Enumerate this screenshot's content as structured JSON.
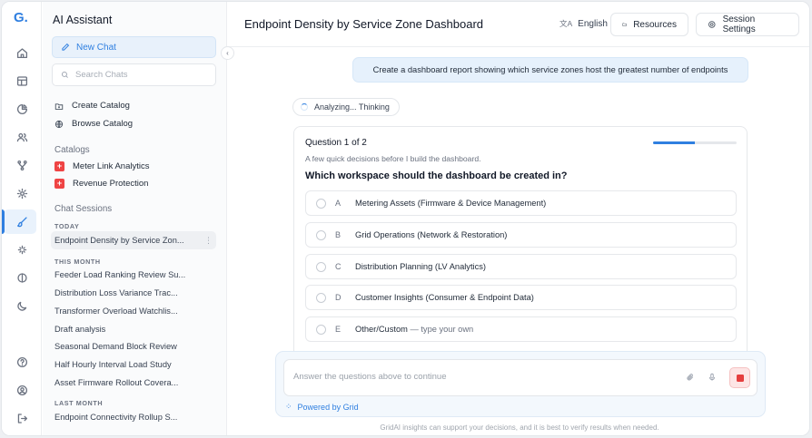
{
  "app": {
    "logo": "G."
  },
  "rail": {
    "icons": [
      "home-icon",
      "layout-icon",
      "pie-chart-icon",
      "users-icon",
      "branch-icon",
      "settings-icon",
      "brush-icon",
      "sparkle-icon",
      "toggle-icon",
      "moon-icon",
      "help-icon",
      "account-icon",
      "logout-icon"
    ],
    "active": "brush-icon"
  },
  "sidebar": {
    "title": "AI Assistant",
    "new_chat": "New Chat",
    "search_placeholder": "Search Chats",
    "create_catalog": "Create Catalog",
    "browse_catalog": "Browse Catalog",
    "catalogs_label": "Catalogs",
    "catalogs": [
      "Meter Link Analytics",
      "Revenue Protection"
    ],
    "sessions_label": "Chat Sessions",
    "groups": {
      "today": "TODAY",
      "this_month": "THIS MONTH",
      "last_month": "LAST MONTH"
    },
    "today": [
      "Endpoint Density by Service Zon..."
    ],
    "this_month": [
      "Feeder Load Ranking Review Su...",
      "Distribution Loss Variance Trac...",
      "Transformer Overload Watchlis...",
      "Draft analysis",
      "Seasonal Demand Block Review",
      "Half Hourly Interval Load Study",
      "Asset Firmware Rollout Covera..."
    ],
    "last_month": [
      "Endpoint Connectivity Rollup S..."
    ],
    "more": "⋮"
  },
  "header": {
    "title": "Endpoint Density by Service Zone Dashboard",
    "language_glyph": "文A",
    "language": "English",
    "resources": "Resources",
    "session_settings": "Session Settings"
  },
  "chat": {
    "user_message": "Create a dashboard report showing which service zones host the greatest number of endpoints",
    "status": "Analyzing... Thinking"
  },
  "question": {
    "counter": "Question 1 of 2",
    "progress": 0.5,
    "subtitle": "A few quick decisions before I build the dashboard.",
    "text": "Which workspace should the dashboard be created in?",
    "options": [
      {
        "letter": "A",
        "label": "Metering Assets (Firmware & Device Management)",
        "hint": ""
      },
      {
        "letter": "B",
        "label": "Grid Operations (Network & Restoration)",
        "hint": ""
      },
      {
        "letter": "C",
        "label": "Distribution Planning (LV Analytics)",
        "hint": ""
      },
      {
        "letter": "D",
        "label": "Customer Insights (Consumer & Endpoint Data)",
        "hint": ""
      },
      {
        "letter": "E",
        "label": "Other/Custom",
        "hint": " — type your own"
      }
    ]
  },
  "composer": {
    "placeholder": "Answer the questions above to continue",
    "powered_by": "Powered by Grid",
    "disclaimer": "GridAI insights can support your decisions, and it is best to verify results when needed."
  },
  "colors": {
    "accent": "#2f7fe0",
    "danger": "#e53e3e",
    "bubble": "#e6f1fc"
  }
}
